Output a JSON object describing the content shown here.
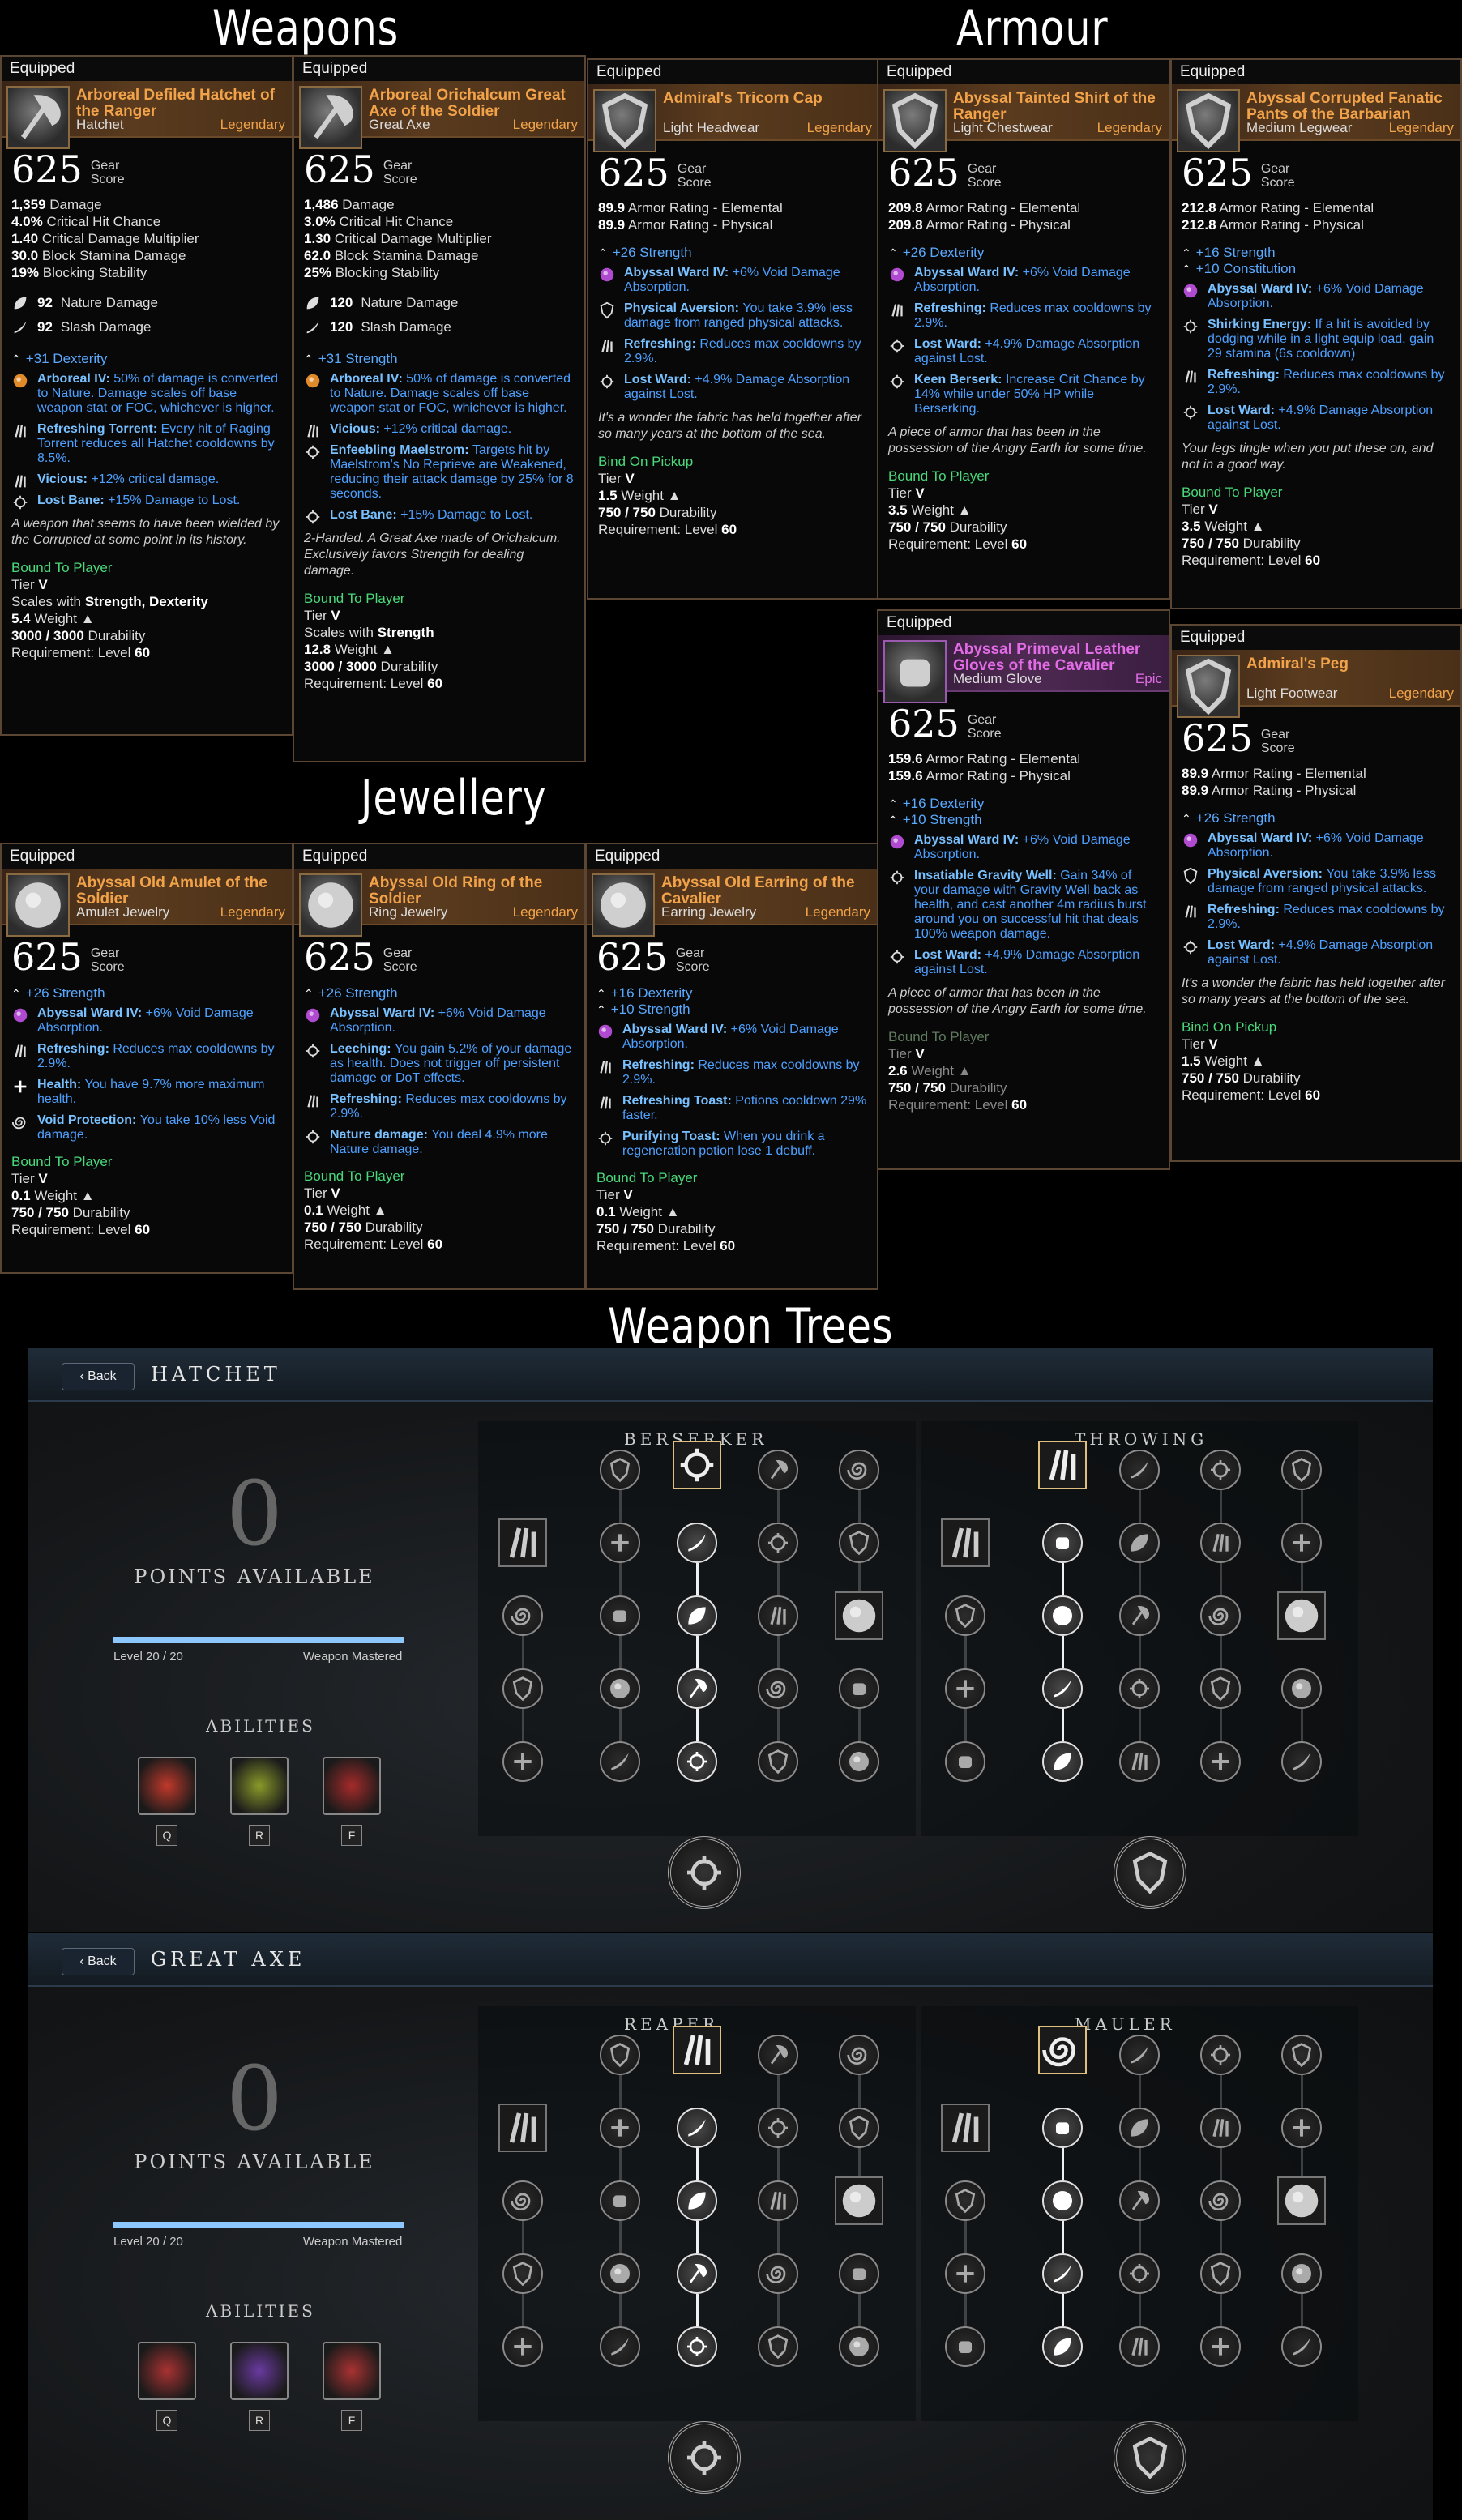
{
  "headings": {
    "weapons": "Weapons",
    "armour": "Armour",
    "jewellery": "Jewellery",
    "weapon_trees": "Weapon Trees"
  },
  "labels": {
    "equipped": "Equipped",
    "gear": "Gear",
    "score": "Score",
    "tier": "Tier",
    "weight": "Weight",
    "durability": "Durability",
    "requirement": "Requirement: Level",
    "back": "Back",
    "points_available": "POINTS AVAILABLE",
    "level": "Level",
    "weapon_mastered": "Weapon Mastered",
    "abilities": "ABILITIES"
  },
  "items": [
    {
      "id": "hatchet",
      "name": "Arboreal Defiled Hatchet of the Ranger",
      "type": "Hatchet",
      "rarity": "Legendary",
      "gear_score": "625",
      "stats": [
        [
          "1,359",
          "Damage"
        ],
        [
          "4.0%",
          "Critical Hit Chance"
        ],
        [
          "1.40",
          "Critical Damage Multiplier"
        ],
        [
          "30.0",
          "Block Stamina Damage"
        ],
        [
          "19%",
          "Blocking Stability"
        ]
      ],
      "damage": [
        [
          "92",
          "Nature Damage"
        ],
        [
          "92",
          "Slash Damage"
        ]
      ],
      "attributes": [
        "+31 Dexterity"
      ],
      "perks": [
        [
          "Arboreal IV:",
          "50% of damage is converted to Nature. Damage scales off base weapon stat or FOC, whichever is higher."
        ],
        [
          "Refreshing Torrent:",
          "Every hit of Raging Torrent reduces all Hatchet cooldowns by 8.5%."
        ],
        [
          "Vicious:",
          "+12% critical damage."
        ],
        [
          "Lost Bane:",
          "+15% Damage to Lost."
        ]
      ],
      "flavor": "A weapon that seems to have been wielded by the Corrupted at some point in its history.",
      "bound": "Bound To Player",
      "tier": "V",
      "scales": "Strength, Dexterity",
      "scales_label": "Scales with",
      "weight": "5.4",
      "durability": "3000 / 3000",
      "level": "60"
    },
    {
      "id": "greataxe",
      "name": "Arboreal Orichalcum Great Axe of the Soldier",
      "type": "Great Axe",
      "rarity": "Legendary",
      "gear_score": "625",
      "stats": [
        [
          "1,486",
          "Damage"
        ],
        [
          "3.0%",
          "Critical Hit Chance"
        ],
        [
          "1.30",
          "Critical Damage Multiplier"
        ],
        [
          "62.0",
          "Block Stamina Damage"
        ],
        [
          "25%",
          "Blocking Stability"
        ]
      ],
      "damage": [
        [
          "120",
          "Nature Damage"
        ],
        [
          "120",
          "Slash Damage"
        ]
      ],
      "attributes": [
        "+31 Strength"
      ],
      "perks": [
        [
          "Arboreal IV:",
          "50% of damage is converted to Nature. Damage scales off base weapon stat or FOC, whichever is higher."
        ],
        [
          "Vicious:",
          "+12% critical damage."
        ],
        [
          "Enfeebling Maelstrom:",
          "Targets hit by Maelstrom's No Reprieve are Weakened, reducing their attack damage by 25% for 8 seconds."
        ],
        [
          "Lost Bane:",
          "+15% Damage to Lost."
        ]
      ],
      "flavor": "2-Handed. A Great Axe made of Orichalcum. Exclusively favors Strength for dealing damage.",
      "bound": "Bound To Player",
      "tier": "V",
      "scales": "Strength",
      "scales_label": "Scales with",
      "weight": "12.8",
      "durability": "3000 / 3000",
      "level": "60"
    },
    {
      "id": "cap",
      "name": "Admiral's Tricorn Cap",
      "type": "Light Headwear",
      "rarity": "Legendary",
      "gear_score": "625",
      "stats": [
        [
          "89.9",
          "Armor Rating - Elemental"
        ],
        [
          "89.9",
          "Armor Rating - Physical"
        ]
      ],
      "attributes": [
        "+26 Strength"
      ],
      "perks": [
        [
          "Abyssal Ward IV:",
          "+6% Void Damage Absorption."
        ],
        [
          "Physical Aversion:",
          "You take 3.9% less damage from ranged physical attacks."
        ],
        [
          "Refreshing:",
          "Reduces max cooldowns by 2.9%."
        ],
        [
          "Lost Ward:",
          "+4.9% Damage Absorption against Lost."
        ]
      ],
      "flavor": "It's a wonder the fabric has held together after so many years at the bottom of the sea.",
      "bound": "Bind On Pickup",
      "tier": "V",
      "weight": "1.5",
      "durability": "750 / 750",
      "level": "60"
    },
    {
      "id": "shirt",
      "name": "Abyssal Tainted Shirt of the Ranger",
      "type": "Light Chestwear",
      "rarity": "Legendary",
      "gear_score": "625",
      "stats": [
        [
          "209.8",
          "Armor Rating - Elemental"
        ],
        [
          "209.8",
          "Armor Rating - Physical"
        ]
      ],
      "attributes": [
        "+26 Dexterity"
      ],
      "perks": [
        [
          "Abyssal Ward IV:",
          "+6% Void Damage Absorption."
        ],
        [
          "Refreshing:",
          "Reduces max cooldowns by 2.9%."
        ],
        [
          "Lost Ward:",
          "+4.9% Damage Absorption against Lost."
        ],
        [
          "Keen Berserk:",
          "Increase Crit Chance by 14% while under 50% HP while Berserking."
        ]
      ],
      "flavor": "A piece of armor that has been in the possession of the Angry Earth for some time.",
      "bound": "Bound To Player",
      "tier": "V",
      "weight": "3.5",
      "durability": "750 / 750",
      "level": "60"
    },
    {
      "id": "pants",
      "name": "Abyssal Corrupted Fanatic Pants of the Barbarian",
      "type": "Medium Legwear",
      "rarity": "Legendary",
      "gear_score": "625",
      "stats": [
        [
          "212.8",
          "Armor Rating - Elemental"
        ],
        [
          "212.8",
          "Armor Rating - Physical"
        ]
      ],
      "attributes": [
        "+16 Strength",
        "+10 Constitution"
      ],
      "perks": [
        [
          "Abyssal Ward IV:",
          "+6% Void Damage Absorption."
        ],
        [
          "Shirking Energy:",
          "If a hit is avoided by dodging while in a light equip load, gain 29 stamina (6s cooldown)"
        ],
        [
          "Refreshing:",
          "Reduces max cooldowns by 2.9%."
        ],
        [
          "Lost Ward:",
          "+4.9% Damage Absorption against Lost."
        ]
      ],
      "flavor": "Your legs tingle when you put these on, and not in a good way.",
      "bound": "Bound To Player",
      "tier": "V",
      "weight": "3.5",
      "durability": "750 / 750",
      "level": "60"
    },
    {
      "id": "gloves",
      "name": "Abyssal Primeval Leather Gloves of the Cavalier",
      "type": "Medium Glove",
      "rarity": "Epic",
      "gear_score": "625",
      "stats": [
        [
          "159.6",
          "Armor Rating - Elemental"
        ],
        [
          "159.6",
          "Armor Rating - Physical"
        ]
      ],
      "attributes": [
        "+16 Dexterity",
        "+10 Strength"
      ],
      "perks": [
        [
          "Abyssal Ward IV:",
          "+6% Void Damage Absorption."
        ],
        [
          "Insatiable Gravity Well:",
          "Gain 34% of your damage with Gravity Well back as health, and cast another 4m radius burst around you on successful hit that deals 100% weapon damage."
        ],
        [
          "Lost Ward:",
          "+4.9% Damage Absorption against Lost."
        ]
      ],
      "flavor": "A piece of armor that has been in the possession of the Angry Earth for some time.",
      "bound": "Bound To Player",
      "tier": "V",
      "weight": "2.6",
      "durability": "750 / 750",
      "level": "60"
    },
    {
      "id": "peg",
      "name": "Admiral's Peg",
      "type": "Light Footwear",
      "rarity": "Legendary",
      "gear_score": "625",
      "stats": [
        [
          "89.9",
          "Armor Rating - Elemental"
        ],
        [
          "89.9",
          "Armor Rating - Physical"
        ]
      ],
      "attributes": [
        "+26 Strength"
      ],
      "perks": [
        [
          "Abyssal Ward IV:",
          "+6% Void Damage Absorption."
        ],
        [
          "Physical Aversion:",
          "You take 3.9% less damage from ranged physical attacks."
        ],
        [
          "Refreshing:",
          "Reduces max cooldowns by 2.9%."
        ],
        [
          "Lost Ward:",
          "+4.9% Damage Absorption against Lost."
        ]
      ],
      "flavor": "It's a wonder the fabric has held together after so many years at the bottom of the sea.",
      "bound": "Bind On Pickup",
      "tier": "V",
      "weight": "1.5",
      "durability": "750 / 750",
      "level": "60"
    },
    {
      "id": "amulet",
      "name": "Abyssal Old Amulet of the Soldier",
      "type": "Amulet Jewelry",
      "rarity": "Legendary",
      "gear_score": "625",
      "stats": [],
      "attributes": [
        "+26 Strength"
      ],
      "perks": [
        [
          "Abyssal Ward IV:",
          "+6% Void Damage Absorption."
        ],
        [
          "Refreshing:",
          "Reduces max cooldowns by 2.9%."
        ],
        [
          "Health:",
          "You have 9.7% more maximum health."
        ],
        [
          "Void Protection:",
          "You take 10% less Void damage."
        ]
      ],
      "flavor": "",
      "bound": "Bound To Player",
      "tier": "V",
      "weight": "0.1",
      "durability": "750 / 750",
      "level": "60"
    },
    {
      "id": "ring",
      "name": "Abyssal Old Ring of the Soldier",
      "type": "Ring Jewelry",
      "rarity": "Legendary",
      "gear_score": "625",
      "stats": [],
      "attributes": [
        "+26 Strength"
      ],
      "perks": [
        [
          "Abyssal Ward IV:",
          "+6% Void Damage Absorption."
        ],
        [
          "Leeching:",
          "You gain 5.2% of your damage as health. Does not trigger off persistent damage or DoT effects."
        ],
        [
          "Refreshing:",
          "Reduces max cooldowns by 2.9%."
        ],
        [
          "Nature damage:",
          "You deal 4.9% more Nature damage."
        ]
      ],
      "flavor": "",
      "bound": "Bound To Player",
      "tier": "V",
      "weight": "0.1",
      "durability": "750 / 750",
      "level": "60"
    },
    {
      "id": "earring",
      "name": "Abyssal Old Earring of the Cavalier",
      "type": "Earring Jewelry",
      "rarity": "Legendary",
      "gear_score": "625",
      "stats": [],
      "attributes": [
        "+16 Dexterity",
        "+10 Strength"
      ],
      "perks": [
        [
          "Abyssal Ward IV:",
          "+6% Void Damage Absorption."
        ],
        [
          "Refreshing:",
          "Reduces max cooldowns by 2.9%."
        ],
        [
          "Refreshing Toast:",
          "Potions cooldown 29% faster."
        ],
        [
          "Purifying Toast:",
          "When you drink a regeneration potion lose 1 debuff."
        ]
      ],
      "flavor": "",
      "bound": "Bound To Player",
      "tier": "V",
      "weight": "0.1",
      "durability": "750 / 750",
      "level": "60"
    }
  ],
  "trees": [
    {
      "id": "hatchet",
      "name": "HATCHET",
      "points": "0",
      "level": "20 / 20",
      "branches": [
        "BERSERKER",
        "THROWING"
      ],
      "keys": [
        "Q",
        "R",
        "F"
      ],
      "ability_colors": [
        "#c0392b",
        "#8a9a2a",
        "#a52a2a"
      ]
    },
    {
      "id": "greataxe",
      "name": "GREAT AXE",
      "points": "0",
      "level": "20 / 20",
      "branches": [
        "REAPER",
        "MAULER"
      ],
      "keys": [
        "Q",
        "R",
        "F"
      ],
      "ability_colors": [
        "#a83232",
        "#6a3aa0",
        "#a83232"
      ]
    }
  ],
  "colors": {
    "legendary": "#f2a34a",
    "epic": "#e26be6",
    "perk": "#4ea0ff",
    "bound": "#49d87a"
  }
}
